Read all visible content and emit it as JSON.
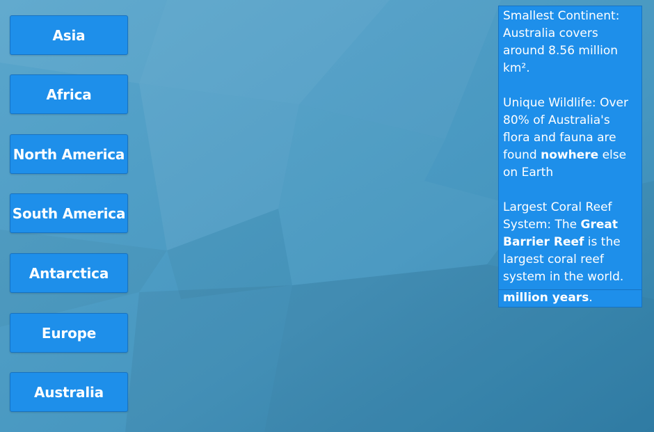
{
  "continents": [
    "Asia",
    "Africa",
    "North America",
    "South America",
    "Antarctica",
    "Europe",
    "Australia"
  ],
  "info": {
    "fact1": "Smallest Continent: Australia covers around 8.56 million km².",
    "fact2_pre": "Unique Wildlife: Over 80% of Australia's flora and fauna are found ",
    "fact2_bold": "nowhere",
    "fact2_post": " else on Earth",
    "fact3_pre": "Largest Coral Reef System: The ",
    "fact3_bold": "Great Barrier Reef",
    "fact3_post": " is the largest coral reef system in the world.",
    "overflow_bold": "million years",
    "overflow_post": "."
  },
  "colors": {
    "background": "#3f8fb8",
    "button": "#1e8fea",
    "button_border": "#1672c2",
    "text": "#ffffff"
  }
}
